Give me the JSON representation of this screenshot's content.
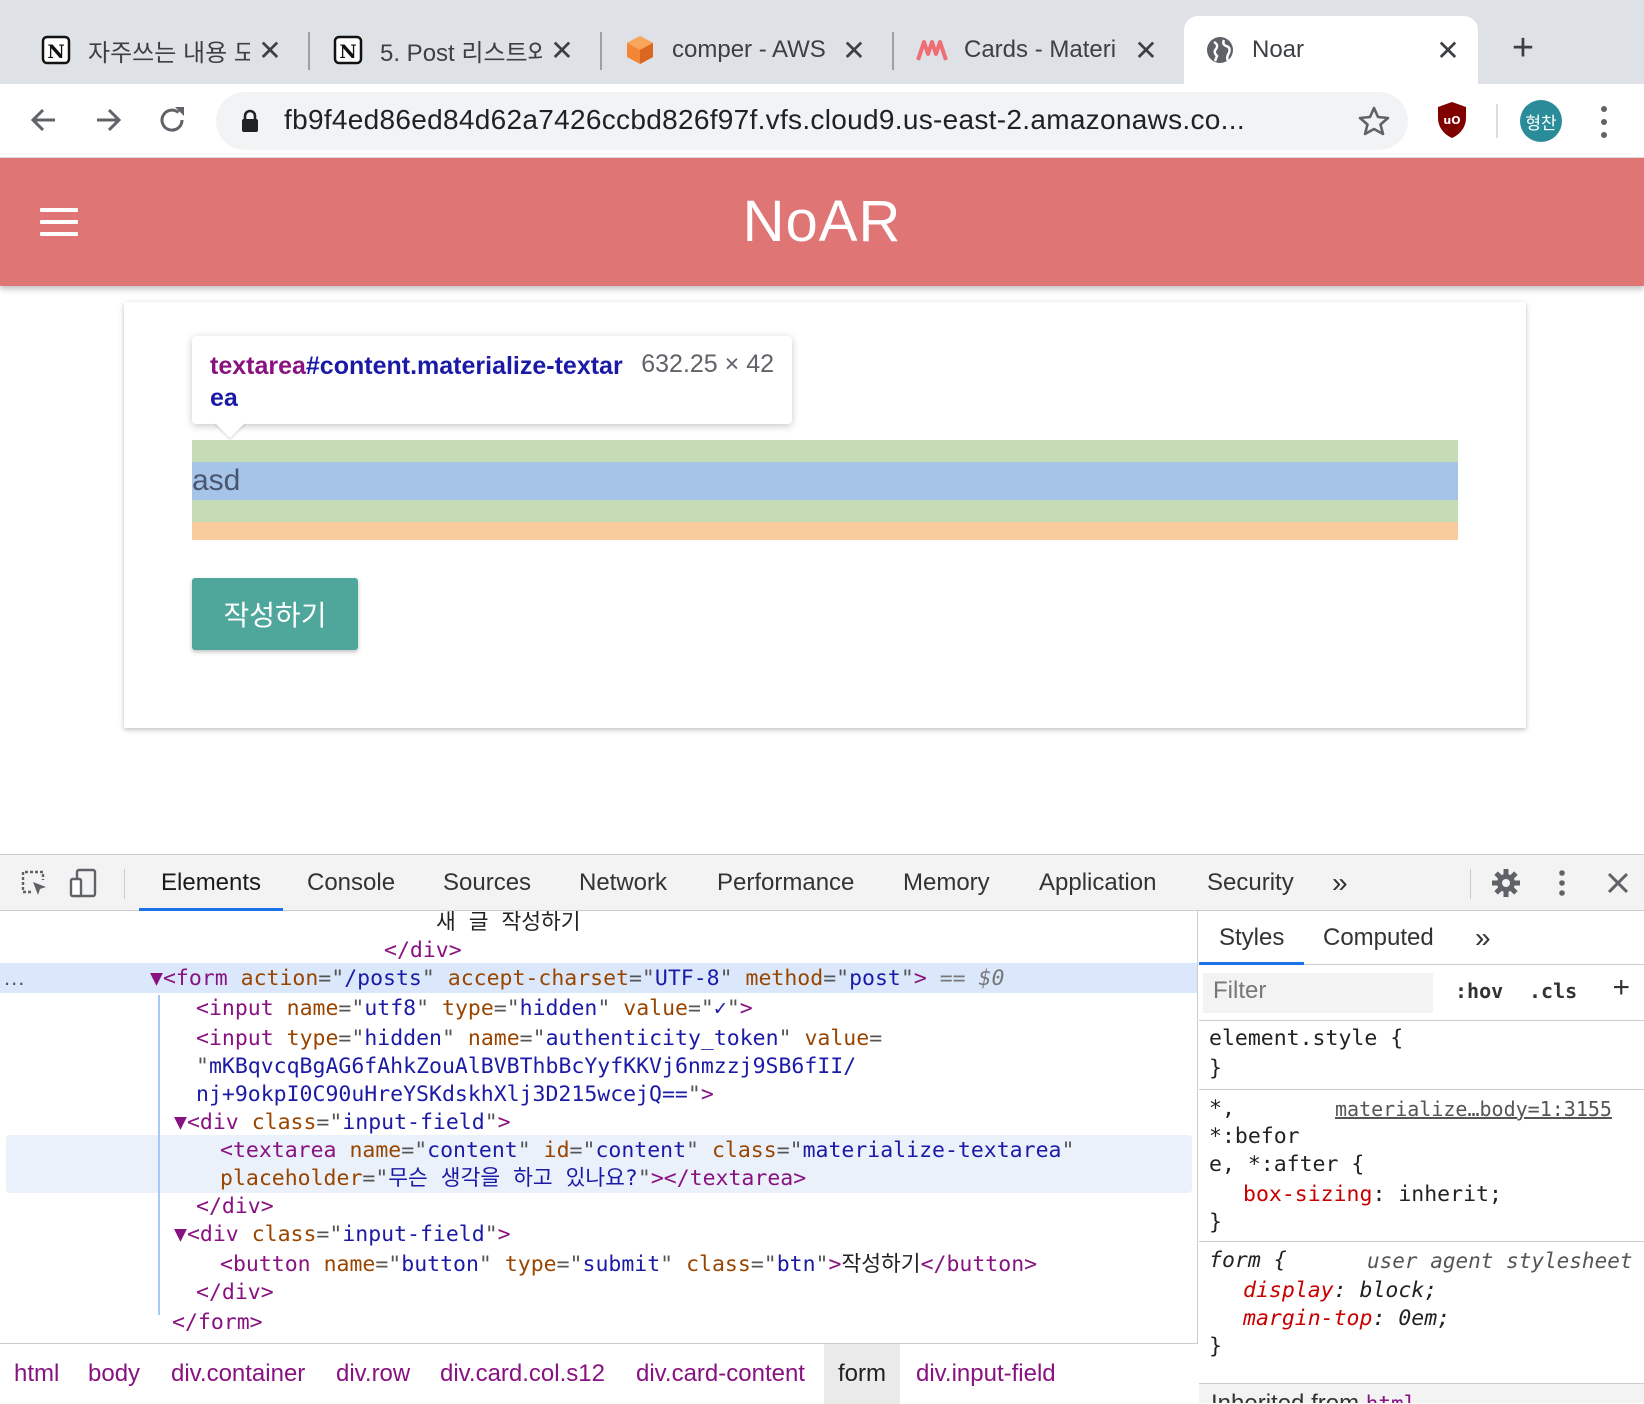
{
  "browser": {
    "tabs": [
      {
        "title": "자주쓰는 내용 모",
        "icon": "notion-icon",
        "active": false
      },
      {
        "title": "5. Post 리스트와",
        "icon": "notion-icon",
        "active": false
      },
      {
        "title": "comper - AWS",
        "icon": "aws-cloud9-icon",
        "active": false
      },
      {
        "title": "Cards - Materi",
        "icon": "materialize-icon",
        "active": false
      },
      {
        "title": "Noar",
        "icon": "globe-icon",
        "active": true
      }
    ],
    "close_glyph": "✕",
    "new_tab_glyph": "+",
    "url": "fb9f4ed86ed84d62a7426ccbd826f97f.vfs.cloud9.us-east-2.amazonaws.co...",
    "profile_name": "형찬",
    "colors": {
      "profile": "#2a8c99",
      "ublock": "#800000"
    }
  },
  "page": {
    "brand": "NoAR",
    "nav_color": "#e07575",
    "textarea_value": "asd",
    "submit_label": "작성하기",
    "submit_color": "#4fa79c",
    "inspect_tooltip": {
      "selector_tag": "textarea",
      "selector_rest": "#content.materialize-textarea",
      "dimensions": "632.25 × 42"
    }
  },
  "devtools": {
    "tabs": [
      "Elements",
      "Console",
      "Sources",
      "Network",
      "Performance",
      "Memory",
      "Application",
      "Security"
    ],
    "active_tab": "Elements",
    "more_glyph": "»",
    "elements": {
      "lines": [
        {
          "t": "txt",
          "text": "새 글 작성하기"
        },
        {
          "t": "close",
          "tag": "div"
        },
        {
          "t": "form_open",
          "tag": "form",
          "attrs": [
            [
              "action",
              "/posts"
            ],
            [
              "accept-charset",
              "UTF-8"
            ],
            [
              "method",
              "post"
            ]
          ],
          "suffix": " == $0"
        },
        {
          "t": "void",
          "tag": "input",
          "attrs": [
            [
              "name",
              "utf8"
            ],
            [
              "type",
              "hidden"
            ],
            [
              "value",
              "✓"
            ]
          ]
        },
        {
          "t": "token",
          "tag": "input",
          "attrs": [
            [
              "type",
              "hidden"
            ],
            [
              "name",
              "authenticity_token"
            ]
          ],
          "value_attr": "value",
          "value_1": "mKBqvcqBgAG6fAhkZouAlBVBThbBcYyfKKVj6nmzzj9SB6fII/",
          "value_2": "nj+9okpI0C90uHreYSKdskhXlj3D215wcejQ=="
        },
        {
          "t": "open",
          "tag": "div",
          "attrs": [
            [
              "class",
              "input-field"
            ]
          ]
        },
        {
          "t": "textarea",
          "tag": "textarea",
          "attrs": [
            [
              "name",
              "content"
            ],
            [
              "id",
              "content"
            ],
            [
              "class",
              "materialize-textarea"
            ]
          ],
          "ph_attr": "placeholder",
          "ph_val": "무슨 생각을 하고 있나요?"
        },
        {
          "t": "close",
          "tag": "div"
        },
        {
          "t": "open",
          "tag": "div",
          "attrs": [
            [
              "class",
              "input-field"
            ]
          ]
        },
        {
          "t": "button",
          "tag": "button",
          "attrs": [
            [
              "name",
              "button"
            ],
            [
              "type",
              "submit"
            ],
            [
              "class",
              "btn"
            ]
          ],
          "text": "작성하기"
        },
        {
          "t": "close",
          "tag": "div"
        },
        {
          "t": "close",
          "tag": "form"
        }
      ],
      "dots": "..."
    },
    "breadcrumbs": [
      "html",
      "body",
      "div.container",
      "div.row",
      "div.card.col.s12",
      "div.card-content",
      "form",
      "div.input-field"
    ],
    "selected_crumb": "form",
    "styles": {
      "tabs": [
        "Styles",
        "Computed"
      ],
      "filter_placeholder": "Filter",
      "hov": ":hov",
      "cls": ".cls",
      "element_style": "element.style {",
      "brace_close": "}",
      "rule1_selector_a": "*,",
      "rule1_selector_b": "*:befor",
      "rule1_selector_c": "e, *:after {",
      "rule1_source": "materialize…body=1:3155",
      "rule1_prop": "box-sizing",
      "rule1_val": "inherit;",
      "rule2_selector": "form {",
      "rule2_source": "user agent stylesheet",
      "rule2_prop1": "display",
      "rule2_val1": "block;",
      "rule2_prop2": "margin-top",
      "rule2_val2": "0em;",
      "inherited_label": "Inherited from",
      "inherited_tag": "html"
    }
  }
}
